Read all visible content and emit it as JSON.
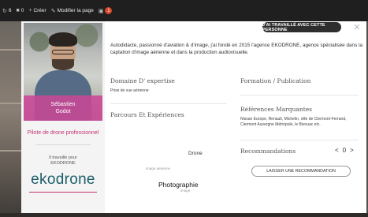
{
  "adminbar": {
    "count_left": "6",
    "comments_count": "0",
    "create_label": "Créer",
    "edit_label": "Modifier la page",
    "notif_count": "1"
  },
  "profile": {
    "first_name": "Sébastien",
    "last_name": "Godot",
    "title": "Pilote de drone professionnel",
    "works_for_label": "Il travaille pour",
    "company_name": "EKODRONE",
    "company_logo_text": "ekodrone"
  },
  "header": {
    "worked_badge": "J'AI TRAVAILLÉ AVEC CETTE PERSONNE"
  },
  "bio": "Autodidacte, passionné d'aviation & d'image, j'ai fondé en 2015 l'agence EKODRONE, agence spécialisée dans la captation d'image aérienne et dans la production audiovisuelle.",
  "sections": {
    "expertise": {
      "title": "Domaine D' expertise",
      "text": "Prise de vue aérienne"
    },
    "training": {
      "title": "Formation / Publication"
    },
    "journeys": {
      "title": "Parcours Et Expériences"
    },
    "references": {
      "title": "Références Marquantes",
      "text": "Nissan Europe, Renault, Michelin, ville de Clermont-Ferrand, Clermont Auvergne Métropole, le Bivouac etc."
    },
    "recommendations": {
      "title": "Recommandations",
      "prev": "<",
      "count": "0",
      "next": ">",
      "button_label": "LAISSER UNE RECOMMANDATION"
    }
  },
  "tag_cloud": {
    "drone": "Drone",
    "aerial_image": "image aerienne",
    "photography": "Photographie",
    "image": "image"
  },
  "colors": {
    "accent_pink": "#c8489a",
    "title_pink": "#c2336e",
    "logo_teal": "#1d5e6b",
    "adminbar_bg": "#1f1f1f",
    "notif_red": "#d9482b"
  }
}
